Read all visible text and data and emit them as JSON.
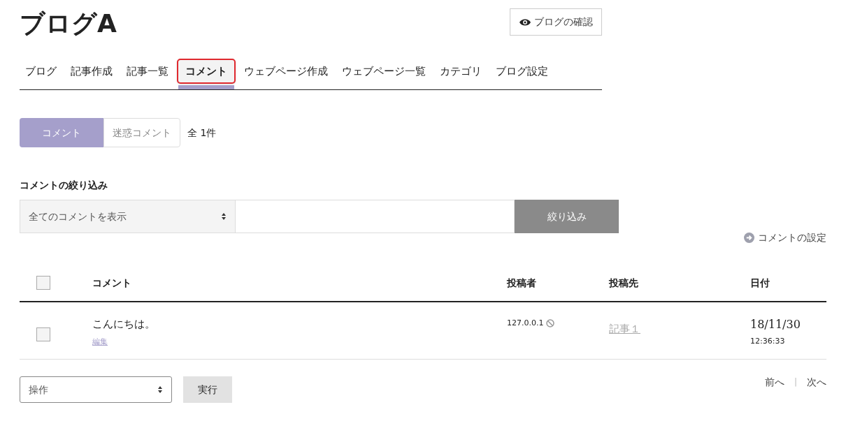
{
  "title": "ブログA",
  "view_button": "ブログの確認",
  "tabs": [
    {
      "label": "ブログ",
      "selected": false
    },
    {
      "label": "記事作成",
      "selected": false
    },
    {
      "label": "記事一覧",
      "selected": false
    },
    {
      "label": "コメント",
      "selected": true
    },
    {
      "label": "ウェブページ作成",
      "selected": false
    },
    {
      "label": "ウェブページ一覧",
      "selected": false
    },
    {
      "label": "カテゴリ",
      "selected": false
    },
    {
      "label": "ブログ設定",
      "selected": false
    }
  ],
  "segments": [
    {
      "label": "コメント",
      "selected": true
    },
    {
      "label": "迷惑コメント",
      "selected": false
    }
  ],
  "total": "全 1件",
  "filter": {
    "heading": "コメントの絞り込み",
    "select": "全てのコメントを表示",
    "button": "絞り込み"
  },
  "settings_link": "コメントの設定",
  "table": {
    "columns": [
      "コメント",
      "投稿者",
      "投稿先",
      "日付"
    ],
    "header_checked": false,
    "rows": [
      {
        "checked": false,
        "comment": "こんにちは。",
        "edit": "編集",
        "author": "127.0.0.1",
        "target": "記事１",
        "date": "18/11/30",
        "time": "12:36:33"
      }
    ]
  },
  "action": {
    "select": "操作",
    "button": "実行"
  },
  "pager": {
    "prev": "前へ",
    "separator": "|",
    "next": "次へ"
  }
}
